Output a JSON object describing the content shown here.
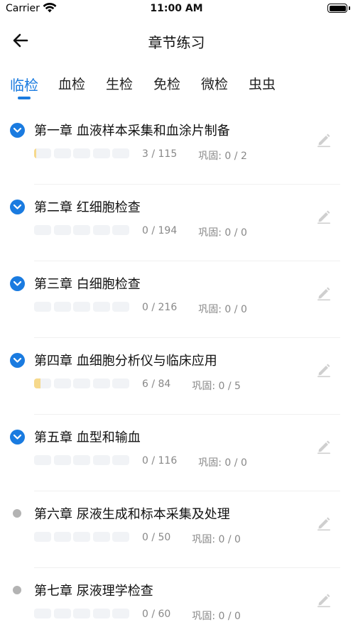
{
  "status_bar": {
    "carrier": "Carrier",
    "time": "11:00 AM"
  },
  "nav": {
    "title": "章节练习",
    "back_icon": "arrow-left-icon"
  },
  "tabs": [
    {
      "label": "临检",
      "active": true
    },
    {
      "label": "血检",
      "active": false
    },
    {
      "label": "生检",
      "active": false
    },
    {
      "label": "免检",
      "active": false
    },
    {
      "label": "微检",
      "active": false
    },
    {
      "label": "虫虫",
      "active": false
    }
  ],
  "colors": {
    "accent": "#1a7be0",
    "progress_fill": "#f6d98c",
    "muted_dot": "#b3b3b3"
  },
  "chapters": [
    {
      "title": "第一章  血液样本采集和血涂片制备",
      "progress": "3 / 115",
      "consolidate": "巩固: 0 / 2",
      "expandable": true,
      "progress_fraction": 0.026
    },
    {
      "title": "第二章  红细胞检查",
      "progress": "0 / 194",
      "consolidate": "巩固: 0 / 0",
      "expandable": true,
      "progress_fraction": 0
    },
    {
      "title": "第三章  白细胞检查",
      "progress": "0 / 216",
      "consolidate": "巩固: 0 / 0",
      "expandable": true,
      "progress_fraction": 0
    },
    {
      "title": "第四章  血细胞分析仪与临床应用",
      "progress": "6 / 84",
      "consolidate": "巩固: 0 / 5",
      "expandable": true,
      "progress_fraction": 0.071
    },
    {
      "title": "第五章  血型和输血",
      "progress": "0 / 116",
      "consolidate": "巩固: 0 / 0",
      "expandable": true,
      "progress_fraction": 0
    },
    {
      "title": "第六章  尿液生成和标本采集及处理",
      "progress": "0 / 50",
      "consolidate": "巩固: 0 / 0",
      "expandable": false,
      "progress_fraction": 0
    },
    {
      "title": "第七章  尿液理学检查",
      "progress": "0 / 60",
      "consolidate": "巩固: 0 / 0",
      "expandable": false,
      "progress_fraction": 0
    }
  ]
}
